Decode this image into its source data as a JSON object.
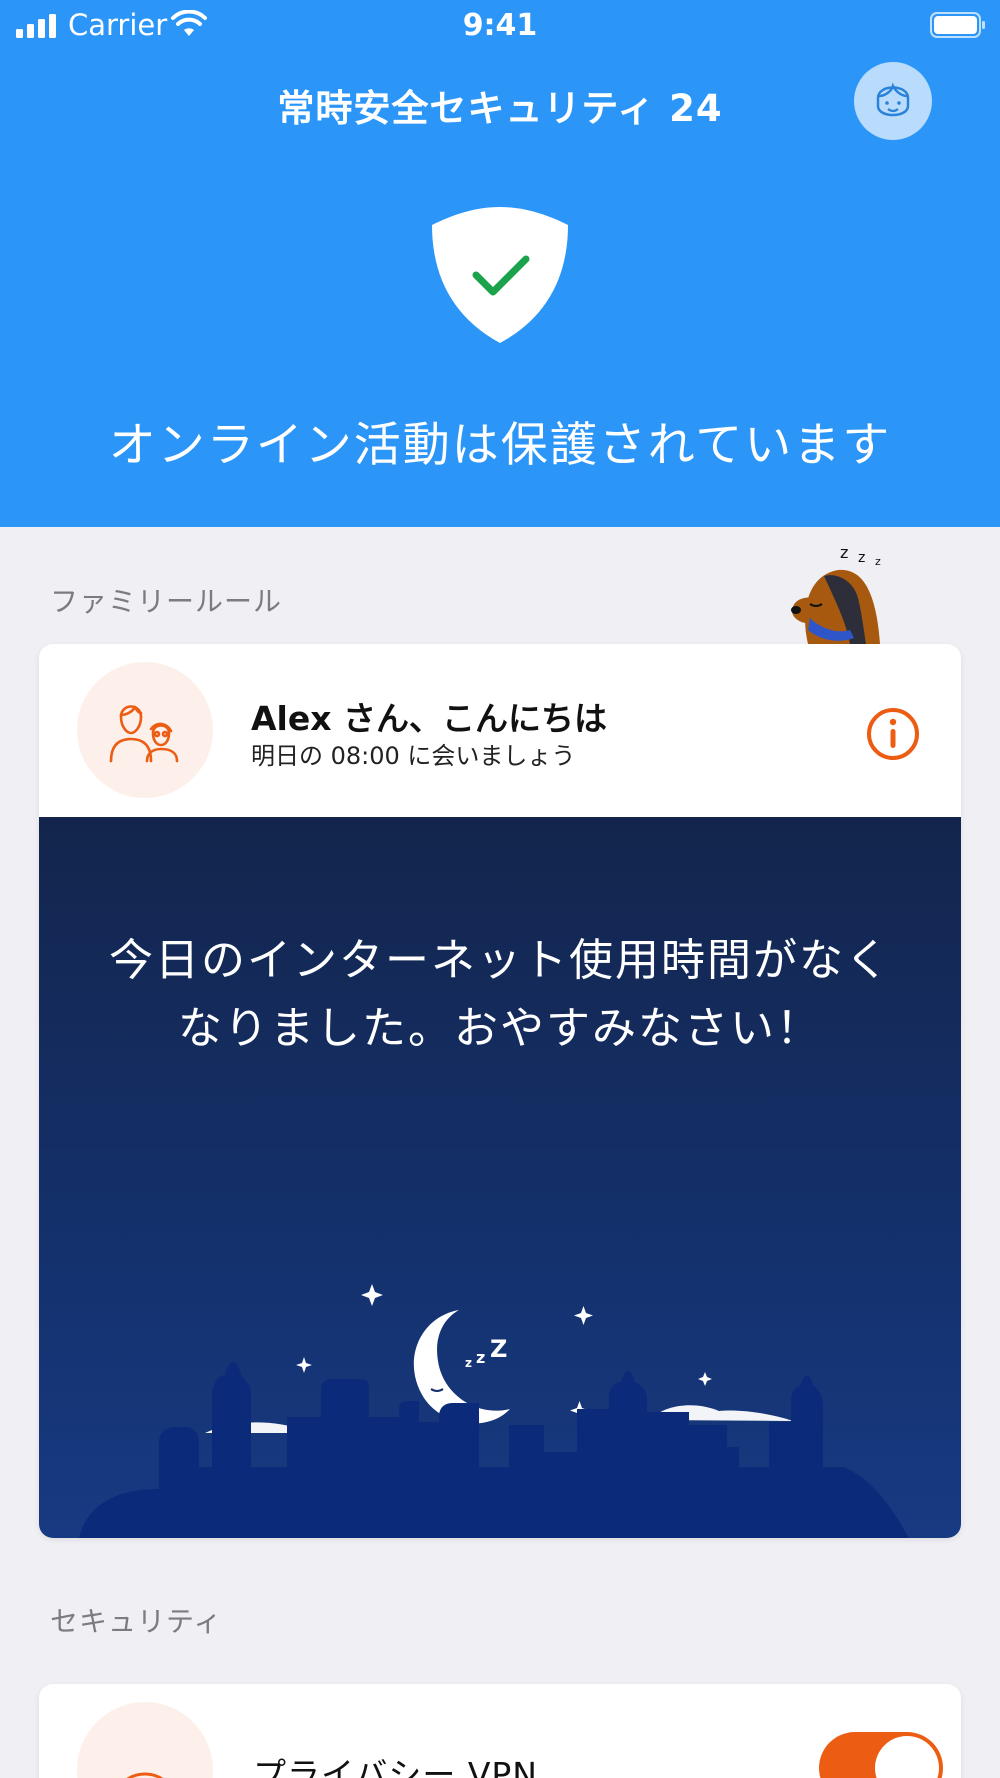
{
  "status_bar": {
    "carrier": "Carrier",
    "time": "9:41"
  },
  "header": {
    "title": "常時安全セキュリティ 24",
    "status_text": "オンライン活動は保護されています",
    "shield_icon": "shield-check-icon",
    "avatar_icon": "user-avatar-icon"
  },
  "family_section": {
    "label": "ファミリールール",
    "card": {
      "greeting": "Alex さん、こんにちは",
      "subtitle": "明日の 08:00 に会いましょう",
      "message": "今日のインターネット使用時間がなくなりました。おやすみなさい！",
      "icons": [
        "family-icon",
        "info-icon",
        "sleeping-moon-icon",
        "sleeping-dog-icon"
      ]
    }
  },
  "security_section": {
    "label": "セキュリティ",
    "vpn": {
      "label": "プライバシー VPN",
      "enabled": true
    }
  },
  "colors": {
    "primary_blue": "#2b96f7",
    "accent_orange": "#ec5d13",
    "night_navy": "#14316d",
    "background": "#f0eff4"
  }
}
